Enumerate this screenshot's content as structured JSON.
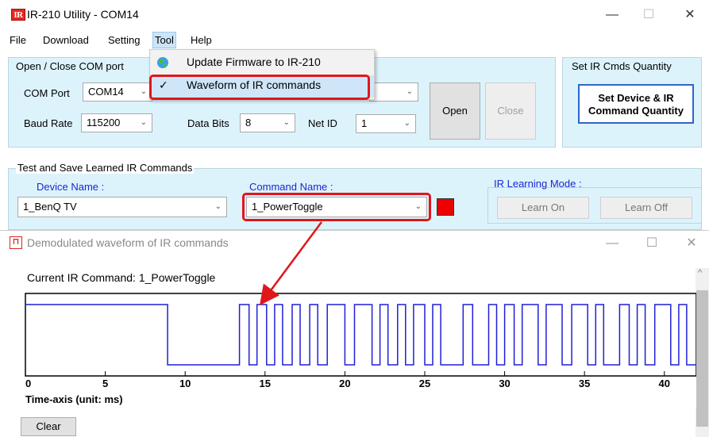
{
  "main_window": {
    "title": "IR-210 Utility - COM14",
    "logo_text": "IR",
    "controls": {
      "minimize": "—",
      "maximize": "☐",
      "close": "✕"
    },
    "menu": [
      "File",
      "Download",
      "Setting",
      "Tool",
      "Help"
    ],
    "tool_menu": {
      "items": [
        {
          "label": "Update Firmware to IR-210",
          "icon": "globe-icon"
        },
        {
          "label": "Waveform of IR commands",
          "icon": "checkmark-icon",
          "checked": true
        }
      ],
      "check_glyph": "✓"
    },
    "com_group": {
      "title": "Open / Close COM port",
      "com_port_label": "COM Port",
      "com_port_value": "COM14",
      "baud_rate_label": "Baud Rate",
      "baud_rate_value": "115200",
      "data_bits_label": "Data Bits",
      "data_bits_value": "8",
      "net_id_label": "Net ID",
      "net_id_value": "1",
      "open_label": "Open",
      "close_label": "Close"
    },
    "ir_qty_group": {
      "title": "Set IR Cmds Quantity",
      "button_label_line1": "Set Device & IR",
      "button_label_line2": "Command Quantity"
    },
    "test_group": {
      "title": "Test and Save Learned IR Commands",
      "device_name_label": "Device Name :",
      "device_name_value": "1_BenQ TV",
      "command_name_label": "Command Name :",
      "command_name_value": "1_PowerToggle",
      "status_color": "#ee0000",
      "learning_mode_label": "IR Learning Mode :",
      "learn_on_label": "Learn On",
      "learn_off_label": "Learn Off"
    }
  },
  "wave_window": {
    "title": "Demodulated waveform of IR commands",
    "icon_glyph": "⊓",
    "controls": {
      "minimize": "—",
      "maximize": "☐",
      "close": "✕"
    },
    "current_command_label": "Current IR Command:",
    "current_command_value": "1_PowerToggle",
    "clear_label": "Clear",
    "scroll_up": "^"
  },
  "chart_data": {
    "type": "line",
    "xlabel": "Time-axis (unit: ms)",
    "xlim": [
      0,
      42
    ],
    "x_ticks": [
      0,
      5,
      10,
      15,
      20,
      25,
      30,
      35,
      40
    ],
    "x_tick_labels": [
      "0",
      "5",
      "10",
      "15",
      "20",
      "25",
      "30",
      "35",
      "40"
    ],
    "series": [
      {
        "color": "#1f1fd8",
        "x": [
          0,
          8.9,
          8.9,
          13.4,
          13.4,
          14.0,
          14.0,
          14.5,
          14.5,
          15.1,
          15.1,
          15.6,
          15.6,
          16.1,
          16.1,
          16.7,
          16.7,
          17.2,
          17.2,
          17.8,
          17.8,
          18.3,
          18.3,
          18.9,
          18.9,
          20.0,
          20.0,
          20.6,
          20.6,
          21.7,
          21.7,
          22.2,
          22.2,
          22.7,
          22.7,
          23.3,
          23.3,
          23.8,
          23.8,
          24.3,
          24.3,
          25.0,
          25.0,
          25.5,
          25.5,
          26.0,
          26.0,
          27.4,
          27.4,
          28.0,
          28.0,
          29.0,
          29.0,
          29.5,
          29.5,
          30.0,
          30.0,
          30.6,
          30.6,
          31.1,
          31.1,
          32.1,
          32.1,
          32.6,
          32.6,
          33.6,
          33.6,
          34.2,
          34.2,
          35.2,
          35.2,
          35.7,
          35.7,
          36.2,
          36.2,
          37.2,
          37.2,
          37.8,
          37.8,
          38.3,
          38.3,
          38.8,
          38.8,
          39.4,
          39.4,
          40.4,
          40.4,
          40.9,
          40.9,
          41.4,
          41.4,
          42.0
        ],
        "y": [
          1,
          1,
          0,
          0,
          1,
          1,
          0,
          0,
          1,
          1,
          0,
          0,
          1,
          1,
          0,
          0,
          1,
          1,
          0,
          0,
          1,
          1,
          0,
          0,
          1,
          1,
          0,
          0,
          1,
          1,
          0,
          0,
          1,
          1,
          0,
          0,
          1,
          1,
          0,
          0,
          1,
          1,
          0,
          0,
          1,
          1,
          0,
          0,
          1,
          1,
          0,
          0,
          1,
          1,
          0,
          0,
          1,
          1,
          0,
          0,
          1,
          1,
          0,
          0,
          1,
          1,
          0,
          0,
          1,
          1,
          0,
          0,
          1,
          1,
          0,
          0,
          1,
          1,
          0,
          0,
          1,
          1,
          0,
          0,
          1,
          1,
          0,
          0,
          1,
          1,
          0,
          0
        ]
      }
    ]
  },
  "annotation": {
    "color": "#e0161b"
  }
}
